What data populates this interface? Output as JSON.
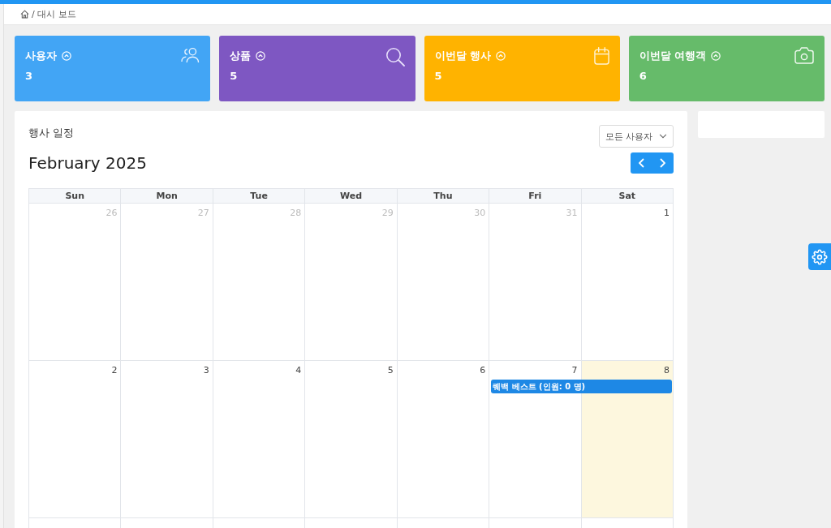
{
  "header": {
    "breadcrumb": "/ 대시 보드"
  },
  "stat_cards": [
    {
      "title": "사용자",
      "value": "3",
      "color": "#42a5f5"
    },
    {
      "title": "상품",
      "value": "5",
      "color": "#7e57c2"
    },
    {
      "title": "이번달 행사",
      "value": "5",
      "color": "#ffb300"
    },
    {
      "title": "이번달 여행객",
      "value": "6",
      "color": "#66bb6a"
    }
  ],
  "schedule": {
    "title": "행사 일정",
    "user_filter": {
      "value": "모든 사용자"
    },
    "month": "February 2025",
    "weekdays": [
      "Sun",
      "Mon",
      "Tue",
      "Wed",
      "Thu",
      "Fri",
      "Sat"
    ],
    "weeks": [
      {
        "days": [
          {
            "day": "26",
            "outside": true,
            "today": false
          },
          {
            "day": "27",
            "outside": true,
            "today": false
          },
          {
            "day": "28",
            "outside": true,
            "today": false
          },
          {
            "day": "29",
            "outside": true,
            "today": false
          },
          {
            "day": "30",
            "outside": true,
            "today": false
          },
          {
            "day": "31",
            "outside": true,
            "today": false
          },
          {
            "day": "1",
            "outside": false,
            "today": false
          }
        ]
      },
      {
        "days": [
          {
            "day": "2",
            "outside": false,
            "today": false
          },
          {
            "day": "3",
            "outside": false,
            "today": false
          },
          {
            "day": "4",
            "outside": false,
            "today": false
          },
          {
            "day": "5",
            "outside": false,
            "today": false
          },
          {
            "day": "6",
            "outside": false,
            "today": false
          },
          {
            "day": "7",
            "outside": false,
            "today": false,
            "events": [
              {
                "label": "퀘백 베스트 (인원: 0 명)",
                "continues": true
              }
            ]
          },
          {
            "day": "8",
            "outside": false,
            "today": true
          }
        ]
      }
    ]
  }
}
